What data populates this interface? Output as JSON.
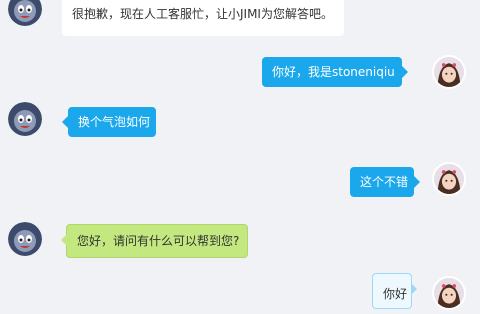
{
  "messages": [
    {
      "side": "left",
      "style": "white",
      "text": "很抱歉，现在人工客服忙，让小JIMI为您解答吧。"
    },
    {
      "side": "right",
      "style": "blue",
      "text": "你好，我是stoneniqiu"
    },
    {
      "side": "left",
      "style": "blue",
      "text": "换个气泡如何"
    },
    {
      "side": "right",
      "style": "blue",
      "text": "这个不错"
    },
    {
      "side": "left",
      "style": "green",
      "text": "您好，请问有什么可以帮到您?"
    },
    {
      "side": "right",
      "style": "outline",
      "text": "你好"
    }
  ],
  "avatars": {
    "bot": "robot-mascot-icon",
    "user": "user-photo-avatar"
  },
  "colors": {
    "background": "#f0f2f5",
    "blue_bubble": "#1aa7ec",
    "green_bubble": "#c3e87f",
    "white_bubble": "#ffffff"
  }
}
